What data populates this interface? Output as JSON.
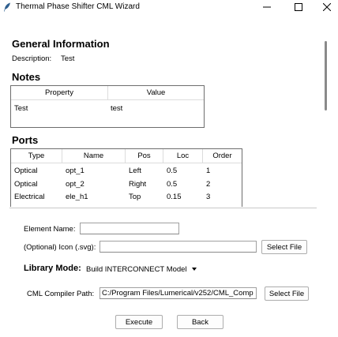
{
  "window": {
    "title": "Thermal Phase Shifter CML Wizard",
    "controls": {
      "minimize": "minimize",
      "maximize": "maximize",
      "close": "close"
    }
  },
  "general": {
    "heading": "General Information",
    "description_label": "Description:",
    "description_value": "Test"
  },
  "notes": {
    "heading": "Notes",
    "columns": [
      "Property",
      "Value"
    ],
    "rows": [
      [
        "Test",
        "test"
      ]
    ]
  },
  "ports": {
    "heading": "Ports",
    "columns": [
      "Type",
      "Name",
      "Pos",
      "Loc",
      "Order"
    ],
    "rows": [
      [
        "Optical",
        "opt_1",
        "Left",
        "0.5",
        "1"
      ],
      [
        "Optical",
        "opt_2",
        "Right",
        "0.5",
        "2"
      ],
      [
        "Electrical",
        "ele_h1",
        "Top",
        "0.15",
        "3"
      ]
    ]
  },
  "form": {
    "element_name_label": "Element Name:",
    "element_name_value": "",
    "icon_label": "(Optional) Icon (.svg):",
    "icon_value": "",
    "select_file_label": "Select File",
    "library_mode_label": "Library Mode:",
    "library_mode_value": "Build INTERCONNECT Model",
    "cml_path_label": "CML Compiler Path:",
    "cml_path_value": "C:/Program Files/Lumerical/v252/CML_Comp",
    "select_file2_label": "Select File",
    "execute_label": "Execute",
    "back_label": "Back"
  }
}
